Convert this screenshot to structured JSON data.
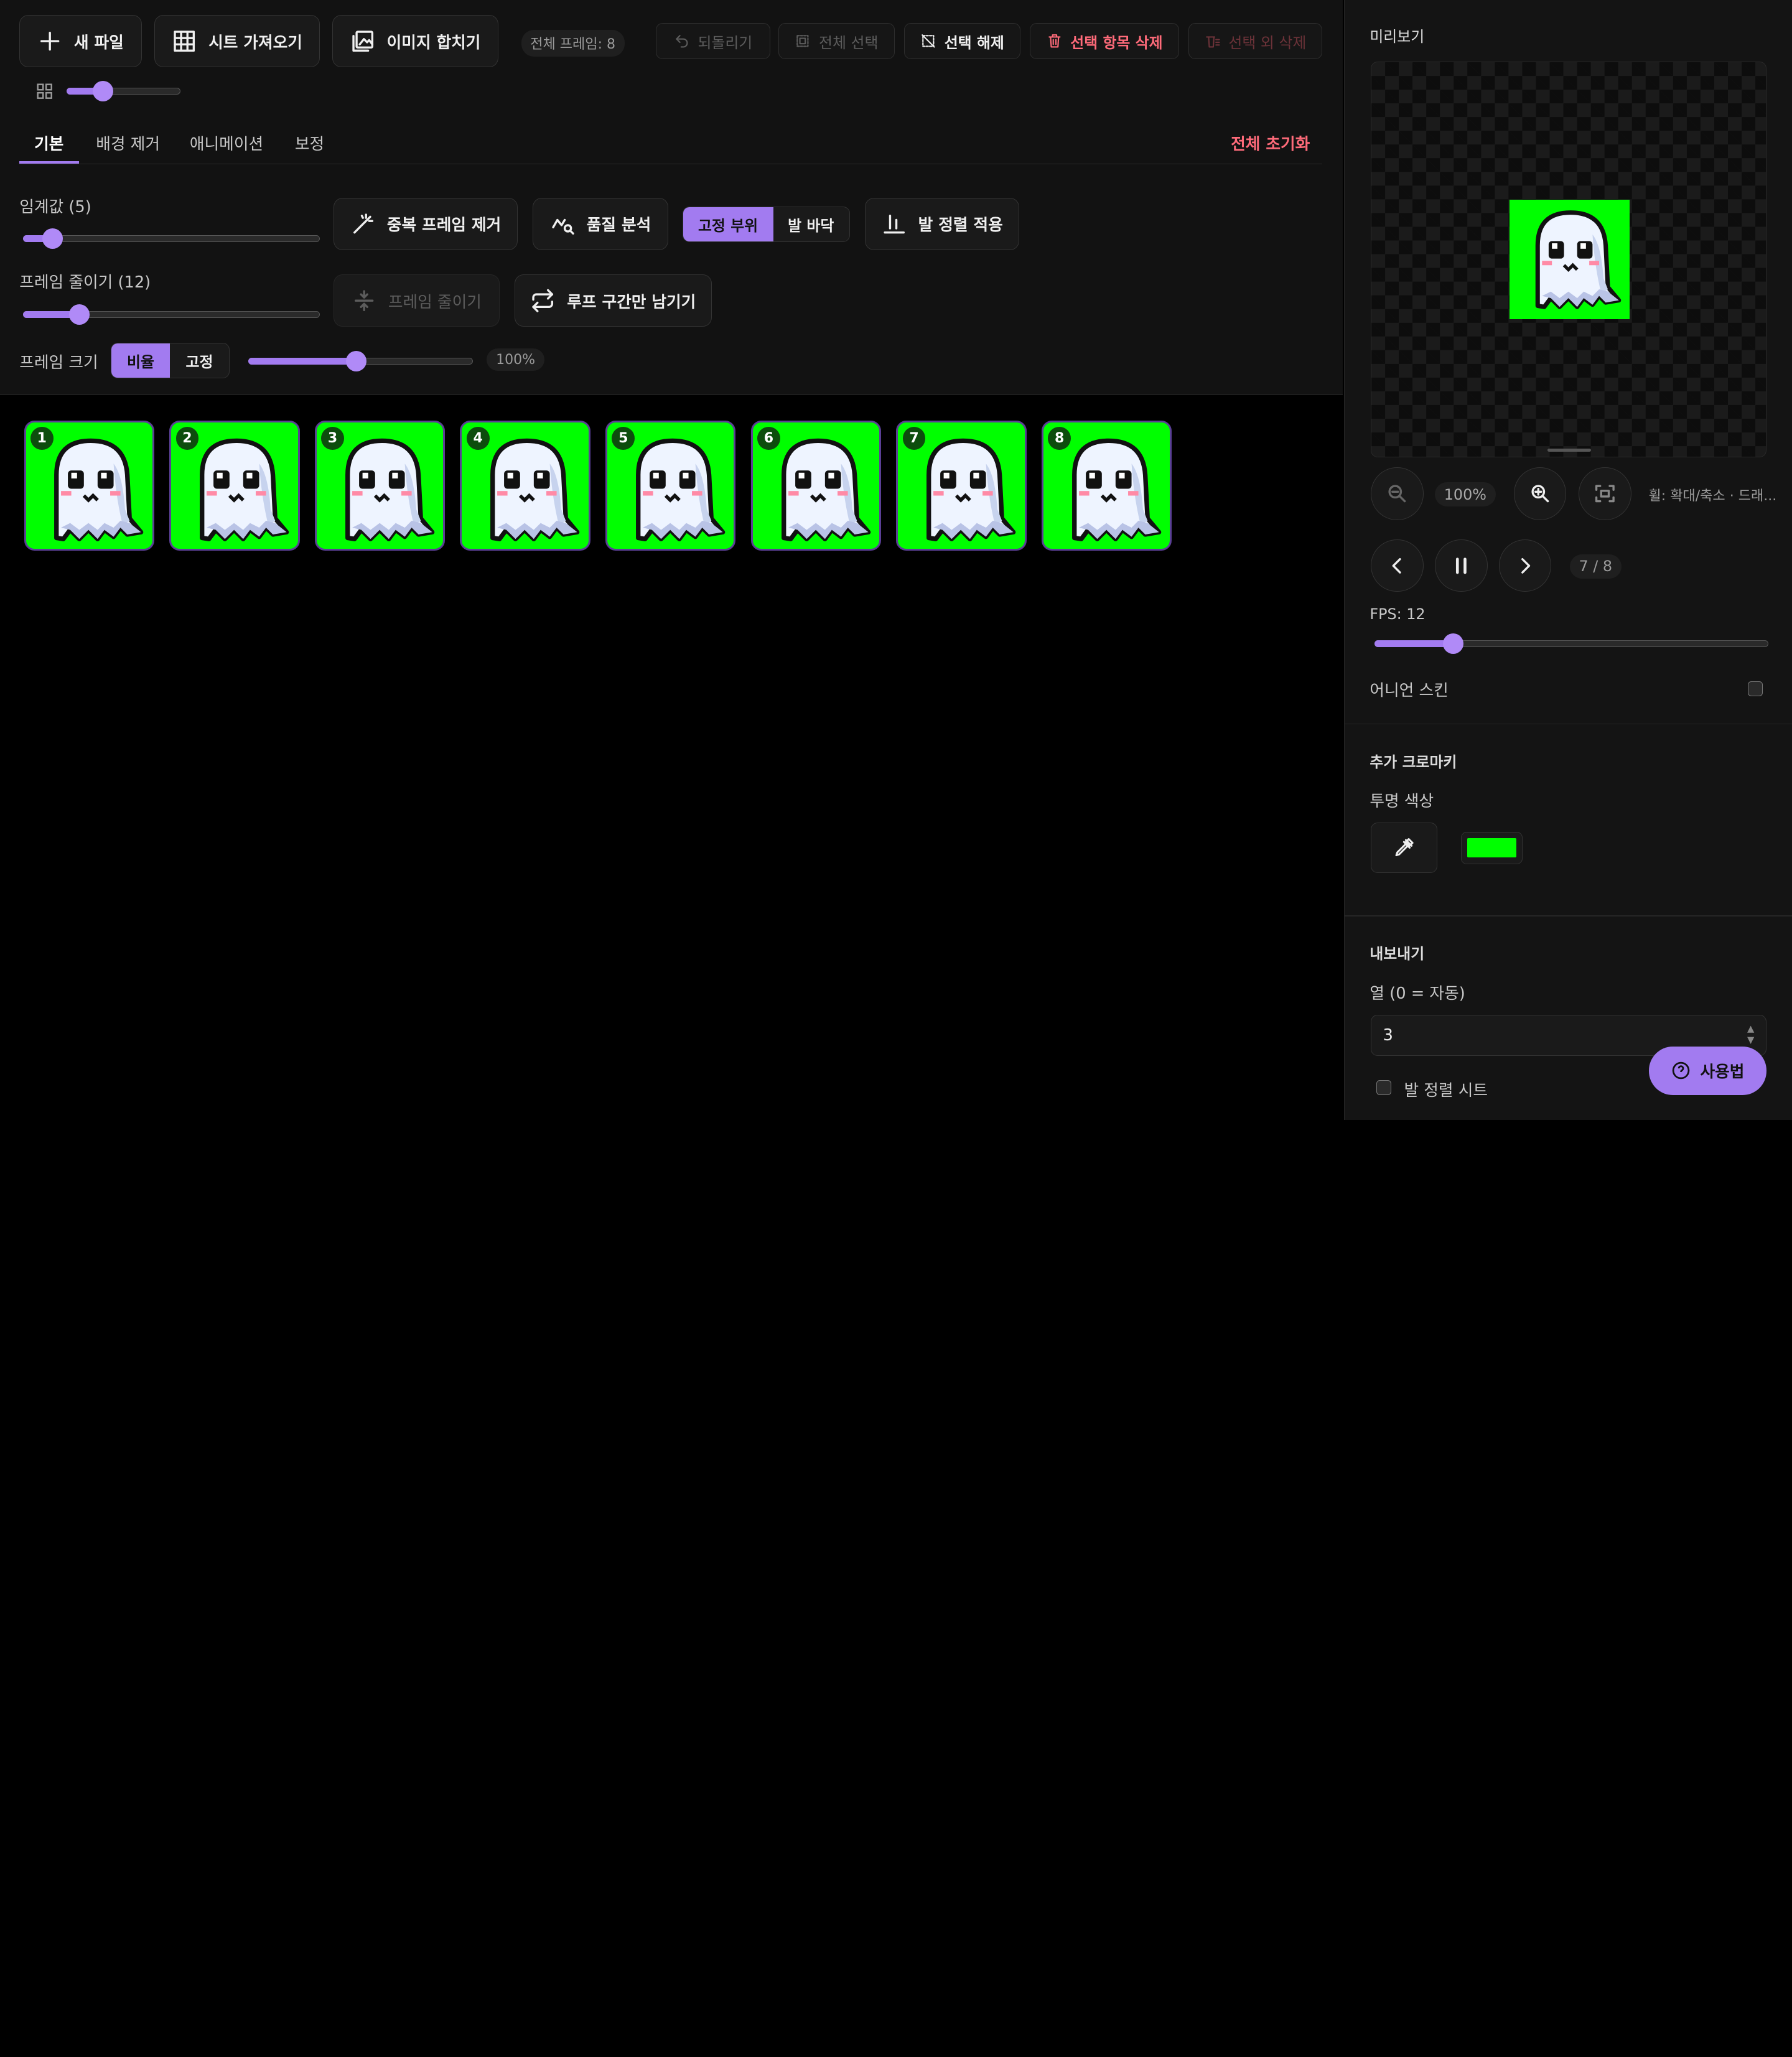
{
  "toolbar": {
    "new_file": "새 파일",
    "import_sheet": "시트 가져오기",
    "merge_images": "이미지 합치기",
    "total_frames": "전체 프레임: 8",
    "undo": "되돌리기",
    "select_all": "전체 선택",
    "deselect": "선택 해제",
    "delete_selected": "선택 항목 삭제",
    "delete_unselected": "선택 외 삭제"
  },
  "thumb_zoom": {
    "level": 0.32
  },
  "tabs": [
    "기본",
    "배경 제거",
    "애니메이션",
    "보정"
  ],
  "active_tab": "기본",
  "reset_all": "전체 초기화",
  "threshold": {
    "label": "임계값 (5)",
    "value": 5,
    "level": 0.1
  },
  "dedupe_button": "중복 프레임 제거",
  "quality_button": "품질 분석",
  "anchor_toggle": {
    "options": [
      "고정 부위",
      "발 바닥"
    ],
    "selected": "고정 부위"
  },
  "foot_align_button": "발 정렬 적용",
  "reduce": {
    "label": "프레임 줄이기 (12)",
    "value": 12,
    "level": 0.19
  },
  "reduce_button": "프레임 줄이기",
  "loop_button": "루프 구간만 남기기",
  "frame_size": {
    "label": "프레임 크기",
    "options": [
      "비율",
      "고정"
    ],
    "selected": "비율",
    "level": 0.48,
    "value_text": "100%"
  },
  "frames": [
    {
      "number": "1"
    },
    {
      "number": "2"
    },
    {
      "number": "3"
    },
    {
      "number": "4"
    },
    {
      "number": "5"
    },
    {
      "number": "6"
    },
    {
      "number": "7"
    },
    {
      "number": "8"
    }
  ],
  "colors": {
    "accent": "#a27bf0",
    "chroma": "#00ff00",
    "danger": "#ff6b7a"
  },
  "preview": {
    "title": "미리보기",
    "zoom_text": "100%",
    "wheel_hint": "휠: 확대/축소 · 드래...",
    "frame_counter": "7 / 8"
  },
  "fps": {
    "label": "FPS: 12",
    "value": 12,
    "level": 0.2
  },
  "onion_skin": {
    "label": "어니언 스킨",
    "checked": false
  },
  "chroma": {
    "title": "추가 크로마키",
    "color_label": "투명 색상",
    "color": "#00ff00"
  },
  "export": {
    "title": "내보내기",
    "columns_label": "열 (0 = 자동)",
    "columns_value": "3",
    "foot_align_sheet": "발 정렬 시트",
    "help_button": "사용법"
  }
}
